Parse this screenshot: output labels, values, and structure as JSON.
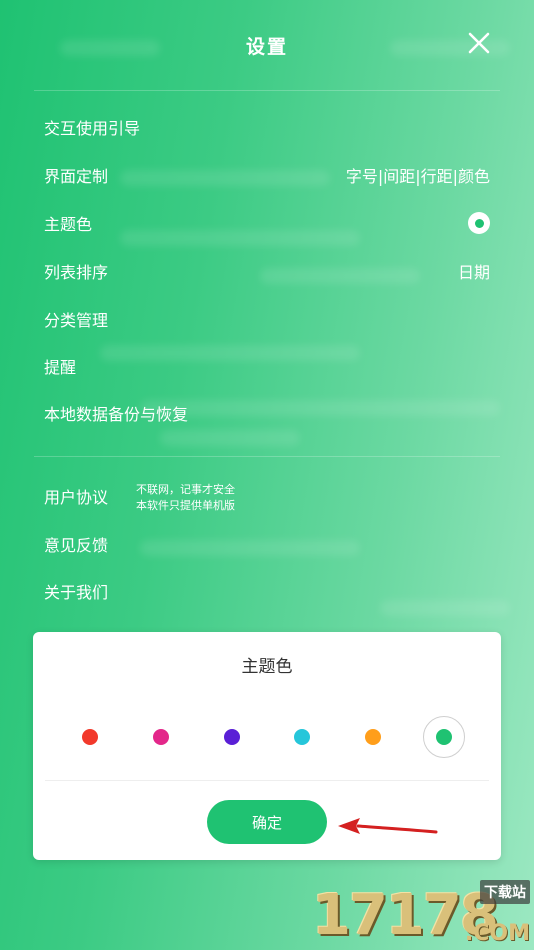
{
  "header": {
    "title": "设置"
  },
  "settings": {
    "items": [
      {
        "label": "交互使用引导",
        "value": ""
      },
      {
        "label": "界面定制",
        "value": "字号|间距|行距|颜色"
      },
      {
        "label": "主题色",
        "value": ""
      },
      {
        "label": "列表排序",
        "value": "日期"
      },
      {
        "label": "分类管理",
        "value": ""
      },
      {
        "label": "提醒",
        "value": ""
      },
      {
        "label": "本地数据备份与恢复",
        "value": ""
      }
    ],
    "items2": [
      {
        "label": "用户协议"
      },
      {
        "label": "意见反馈"
      },
      {
        "label": "关于我们"
      }
    ],
    "note_line1": "不联网，记事才安全",
    "note_line2": "本软件只提供单机版"
  },
  "dialog": {
    "title": "主题色",
    "colors": [
      "#f2392b",
      "#e3278a",
      "#5a1fd6",
      "#26c6da",
      "#ff9e1b",
      "#1fc272"
    ],
    "selected_index": 5,
    "confirm_label": "确定"
  },
  "watermark": {
    "digits": "17178",
    "tag": "下载站",
    "com": ".COM"
  },
  "colors": {
    "accent": "#1fc272",
    "arrow": "#d42020"
  }
}
